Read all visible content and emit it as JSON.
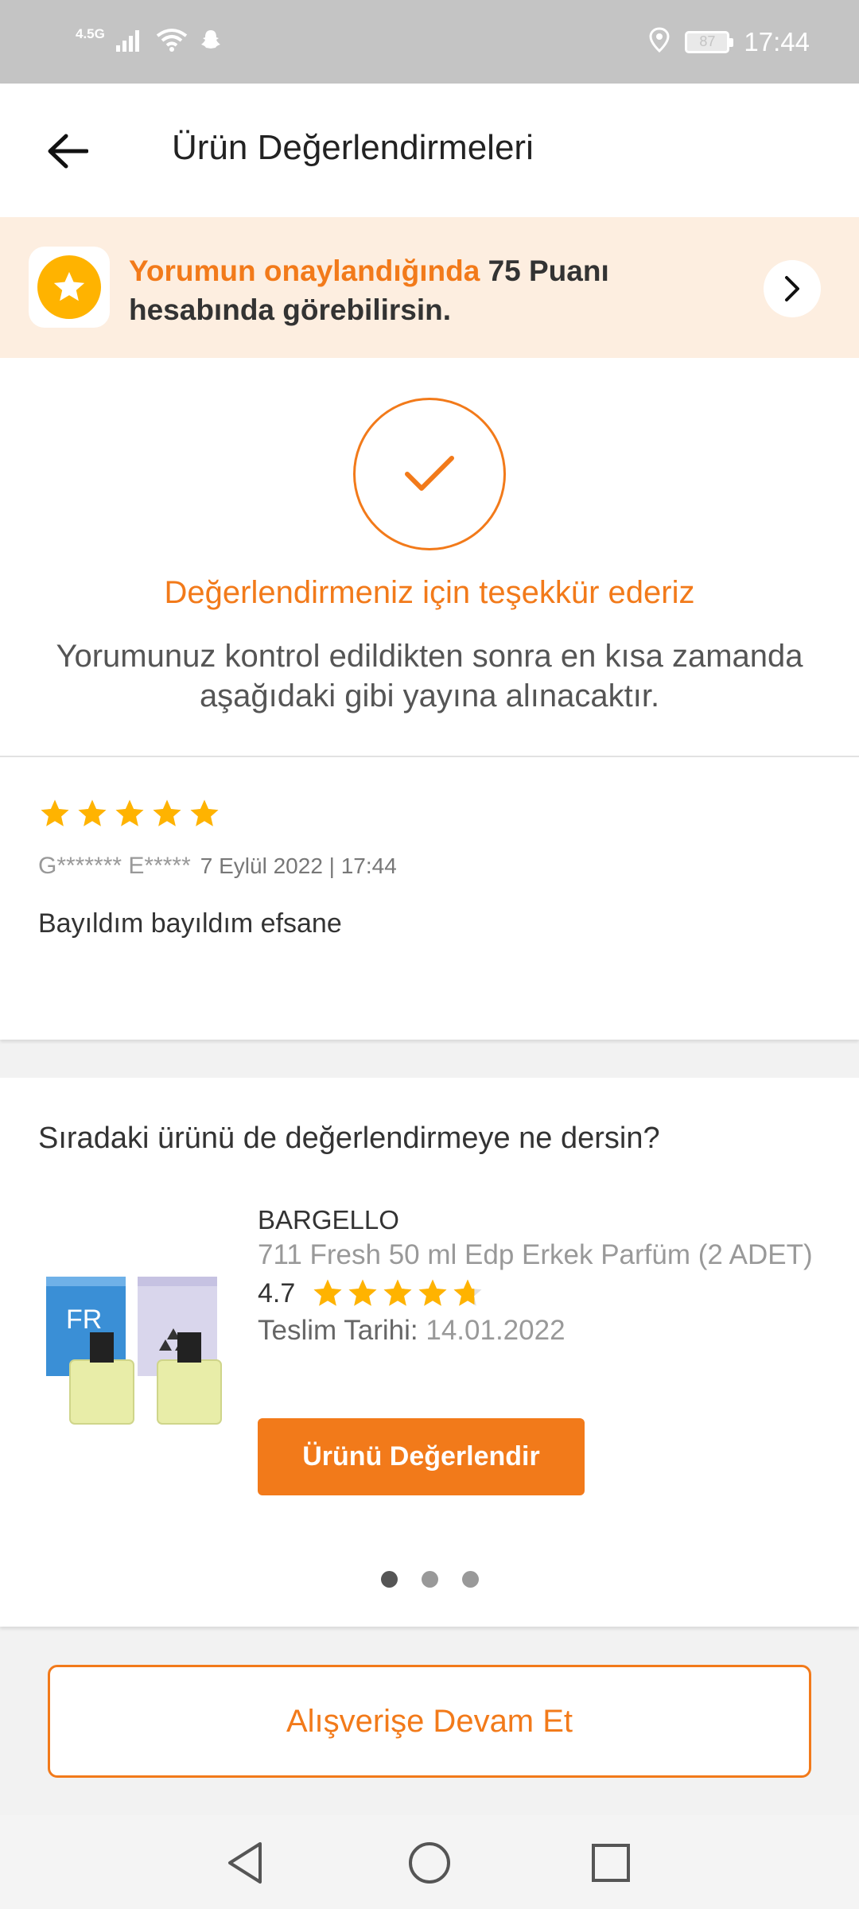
{
  "status_bar": {
    "network": "4.5G",
    "battery": "87",
    "time": "17:44"
  },
  "header": {
    "title": "Ürün Değerlendirmeleri"
  },
  "banner": {
    "highlight": "Yorumun onaylandığında",
    "points": "75 Puanı",
    "rest": "hesabında görebilirsin."
  },
  "thanks": {
    "title": "Değerlendirmeniz için teşekkür ederiz",
    "description": "Yorumunuz kontrol edildikten sonra en kısa zamanda aşağıdaki gibi yayına alınacaktır."
  },
  "review": {
    "rating": 5,
    "user": "G******* E*****",
    "date": "7 Eylül 2022 | 17:44",
    "text": "Bayıldım bayıldım efsane"
  },
  "next_product": {
    "section_title": "Sıradaki ürünü de değerlendirmeye ne dersin?",
    "brand": "BARGELLO",
    "name": "711 Fresh 50 ml Edp Erkek Parfüm (2 ADET)",
    "rating_value": "4.7",
    "rating": 4.7,
    "delivery_label": "Teslim Tarihi:",
    "delivery_date": "14.01.2022",
    "button_label": "Ürünü Değerlendir",
    "carousel_pages": 3,
    "carousel_active": 0
  },
  "continue_button": "Alışverişe Devam Et",
  "colors": {
    "accent": "#f27a1a",
    "star": "#ffb300",
    "banner_bg": "#fdeee0"
  }
}
